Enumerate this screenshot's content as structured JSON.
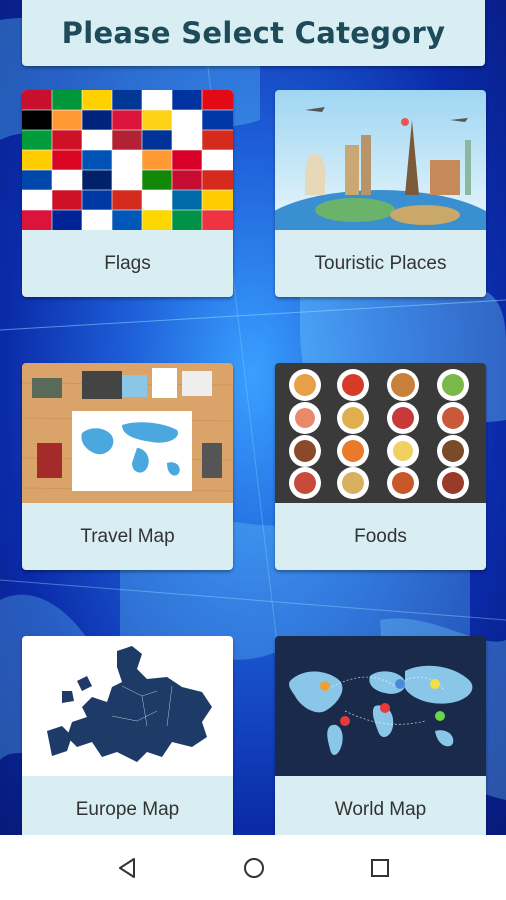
{
  "header": {
    "title": "Please Select Category"
  },
  "categories": [
    {
      "label": "Flags",
      "icon": "flags-collage-image"
    },
    {
      "label": "Touristic Places",
      "icon": "landmarks-globe-image"
    },
    {
      "label": "Travel Map",
      "icon": "travel-desk-map-image"
    },
    {
      "label": "Foods",
      "icon": "food-plates-image"
    },
    {
      "label": "Europe Map",
      "icon": "europe-map-image"
    },
    {
      "label": "World Map",
      "icon": "world-map-pins-image"
    }
  ],
  "navigation": {
    "back": "back-icon",
    "home": "home-icon",
    "recents": "recents-icon"
  },
  "colors": {
    "card_bg": "#d8eef2",
    "title_text": "#1e4b5a",
    "background": "#0a2aa8"
  }
}
